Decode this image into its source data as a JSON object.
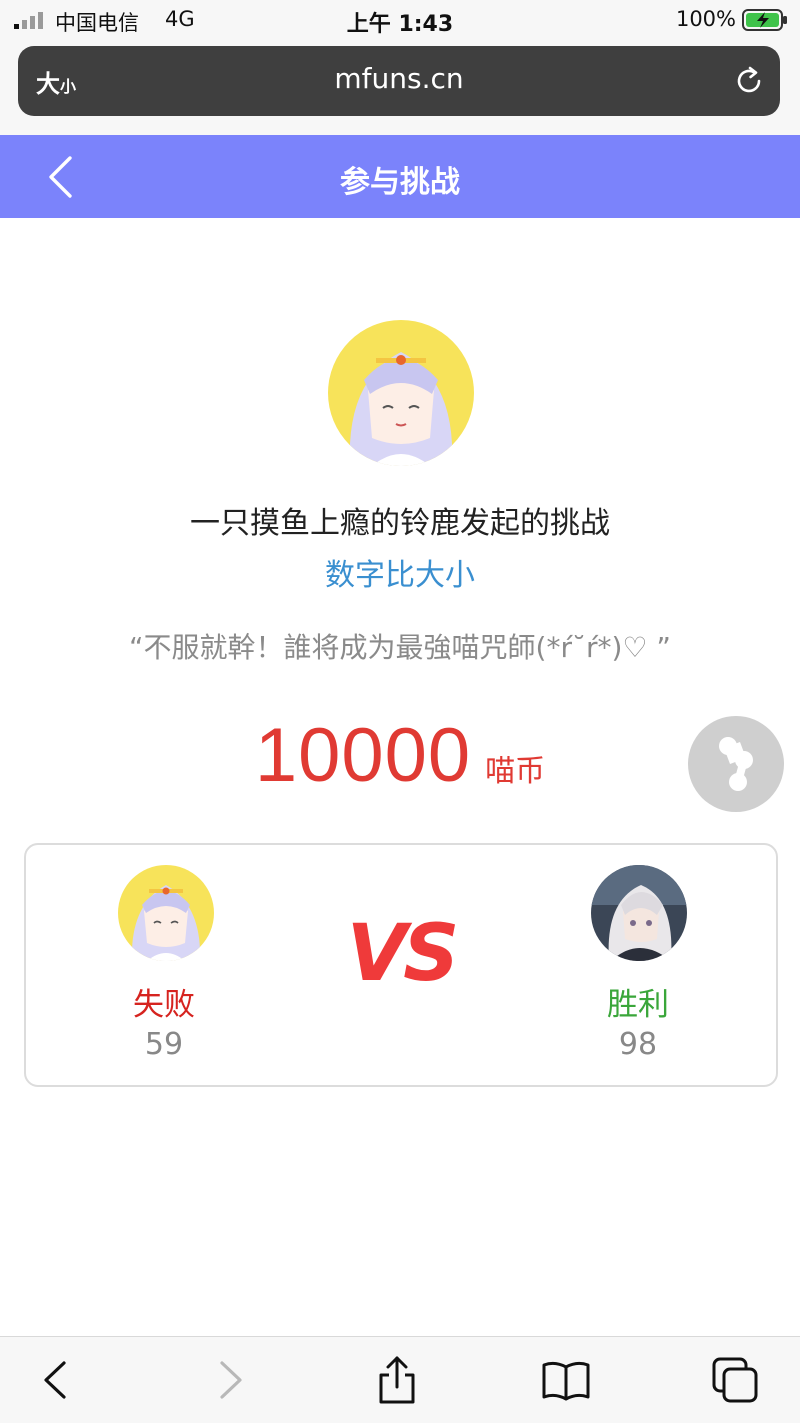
{
  "status_bar": {
    "carrier": "中国电信",
    "network": "4G",
    "time": "上午 1:43",
    "battery": "100%"
  },
  "browser": {
    "text_size_label": "大",
    "text_size_small": "小",
    "url": "mfuns.cn",
    "reload_icon": "reload-icon"
  },
  "header": {
    "title": "参与挑战",
    "back_icon": "chevron-left-icon",
    "color": "#7b83fb"
  },
  "challenge": {
    "challenger_text": "一只摸鱼上瘾的铃鹿发起的挑战",
    "game_type": "数字比大小",
    "quote": "“不服就幹！誰将成为最強喵咒師(*ŕ˘ŕ*)♡ ”",
    "stake_amount": "10000",
    "stake_unit": "喵币"
  },
  "vs_card": {
    "vs_label": "VS",
    "player1": {
      "result": "失败",
      "score": "59",
      "result_color": "#d6231f"
    },
    "player2": {
      "result": "胜利",
      "score": "98",
      "result_color": "#3aa63a"
    }
  },
  "toolbar": {
    "items": [
      "back-arrow-icon",
      "forward-arrow-icon",
      "share-icon",
      "bookmarks-icon",
      "tabs-icon"
    ]
  }
}
